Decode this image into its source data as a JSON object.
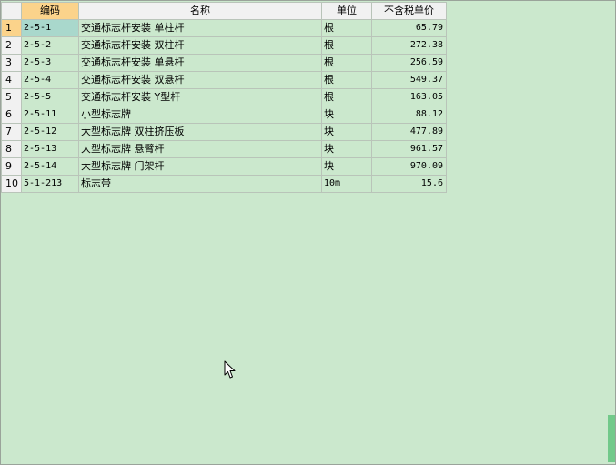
{
  "columns": {
    "code": "编码",
    "name": "名称",
    "unit": "单位",
    "price": "不含税单价"
  },
  "rows": [
    {
      "num": "1",
      "code": "2-5-1",
      "name": "交通标志杆安装 单柱杆",
      "unit": "根",
      "price": "65.79"
    },
    {
      "num": "2",
      "code": "2-5-2",
      "name": "交通标志杆安装 双柱杆",
      "unit": "根",
      "price": "272.38"
    },
    {
      "num": "3",
      "code": "2-5-3",
      "name": "交通标志杆安装 单悬杆",
      "unit": "根",
      "price": "256.59"
    },
    {
      "num": "4",
      "code": "2-5-4",
      "name": "交通标志杆安装 双悬杆",
      "unit": "根",
      "price": "549.37"
    },
    {
      "num": "5",
      "code": "2-5-5",
      "name": "交通标志杆安装 Y型杆",
      "unit": "根",
      "price": "163.05"
    },
    {
      "num": "6",
      "code": "2-5-11",
      "name": "小型标志牌",
      "unit": "块",
      "price": "88.12"
    },
    {
      "num": "7",
      "code": "2-5-12",
      "name": "大型标志牌 双柱挤压板",
      "unit": "块",
      "price": "477.89"
    },
    {
      "num": "8",
      "code": "2-5-13",
      "name": "大型标志牌 悬臂杆",
      "unit": "块",
      "price": "961.57"
    },
    {
      "num": "9",
      "code": "2-5-14",
      "name": "大型标志牌 门架杆",
      "unit": "块",
      "price": "970.09"
    },
    {
      "num": "10",
      "code": "5-1-213",
      "name": "标志带",
      "unit": "10m",
      "price": "15.6"
    }
  ]
}
